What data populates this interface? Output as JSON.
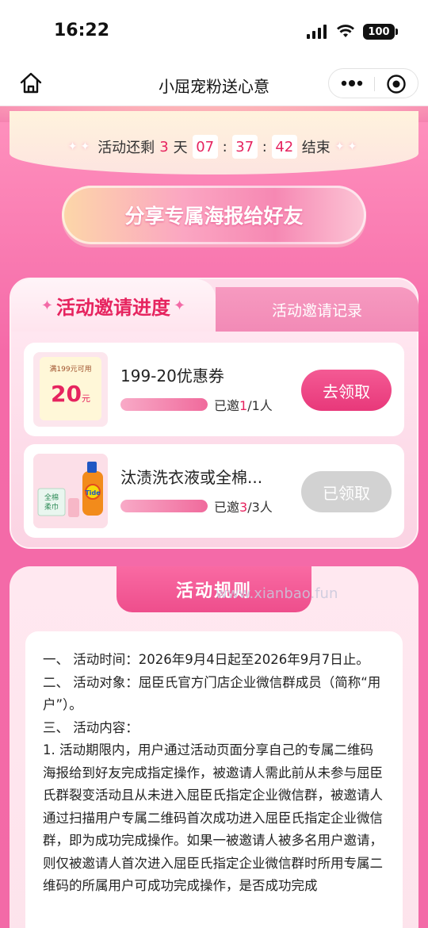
{
  "status": {
    "time": "16:22",
    "battery": "100"
  },
  "nav": {
    "title": "小屈宠粉送心意"
  },
  "countdown": {
    "prefix": "活动还剩",
    "days": "3",
    "day_unit": "天",
    "hours": "07",
    "minutes": "37",
    "seconds": "42",
    "sep": ":",
    "suffix": "结束"
  },
  "share_button": {
    "label": "分享专属海报给好友"
  },
  "tabs": {
    "active": "活动邀请进度",
    "inactive": "活动邀请记录"
  },
  "rewards": [
    {
      "name": "199-20优惠券",
      "coupon_condition": "满199元可用",
      "coupon_amount": "20",
      "coupon_unit": "元",
      "invited_label": "已邀",
      "invited": "1",
      "total": "/1人",
      "progress": 1.0,
      "button": "去领取",
      "state": "active"
    },
    {
      "name": "汰渍洗衣液或全棉...",
      "invited_label": "已邀",
      "invited": "3",
      "total": "/3人",
      "progress": 1.0,
      "button": "已领取",
      "state": "done",
      "thumb_text": "全棉柔巾"
    }
  ],
  "rules": {
    "title": "活动规则",
    "watermark": "www.xianbao.fun",
    "lines": [
      "一、 活动时间：2026年9月4日起至2026年9月7日止。",
      "二、 活动对象：屈臣氏官方门店企业微信群成员（简称“用户”）。",
      "三、 活动内容：",
      "1. 活动期限内，用户通过活动页面分享自己的专属二维码海报给到好友完成指定操作，被邀请人需此前从未参与屈臣氏群裂变活动且从未进入屈臣氏指定企业微信群，被邀请人通过扫描用户专属二维码首次成功进入屈臣氏指定企业微信群，即为成功完成操作。如果一被邀请人被多名用户邀请，则仅被邀请人首次进入屈臣氏指定企业微信群时所用专属二维码的所属用户可成功完成操作，是否成功完成"
    ]
  },
  "colors": {
    "accent": "#e6245f",
    "bg": "#f36aa7"
  }
}
